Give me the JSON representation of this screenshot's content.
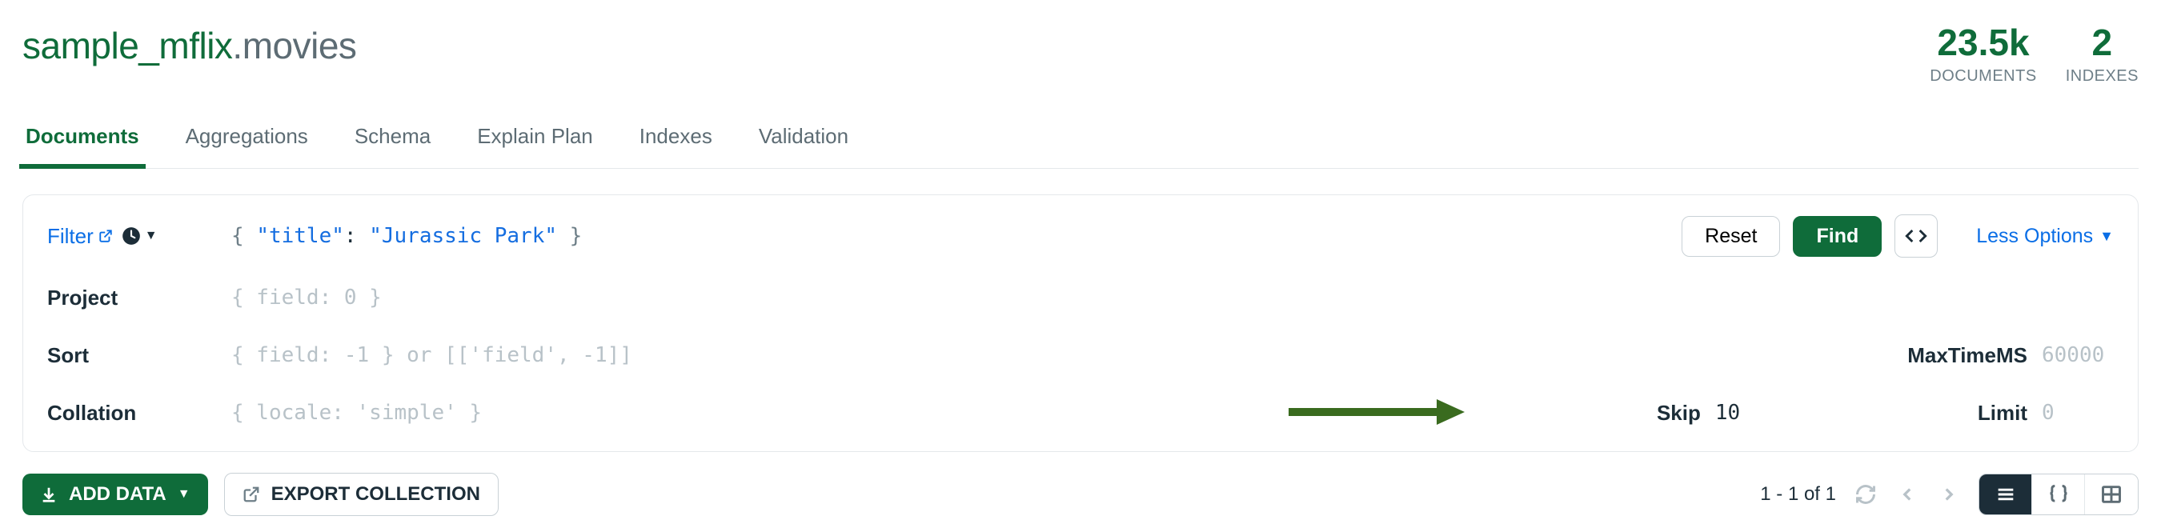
{
  "header": {
    "database": "sample_mflix",
    "collection": ".movies",
    "stats": {
      "documents_value": "23.5k",
      "documents_label": "DOCUMENTS",
      "indexes_value": "2",
      "indexes_label": "INDEXES"
    }
  },
  "tabs": {
    "documents": "Documents",
    "aggregations": "Aggregations",
    "schema": "Schema",
    "explain_plan": "Explain Plan",
    "indexes": "Indexes",
    "validation": "Validation"
  },
  "query": {
    "filter_label": "Filter",
    "filter_value_open": "{",
    "filter_key": "\"title\"",
    "filter_colon": ": ",
    "filter_str": "\"Jurassic Park\"",
    "filter_value_close": "}",
    "project_label": "Project",
    "project_placeholder": "{ field: 0 }",
    "sort_label": "Sort",
    "sort_placeholder": "{ field: -1 } or [['field', -1]]",
    "collation_label": "Collation",
    "collation_placeholder": "{ locale: 'simple' }",
    "maxtime_label": "MaxTimeMS",
    "maxtime_placeholder": "60000",
    "skip_label": "Skip",
    "skip_value": "10",
    "limit_label": "Limit",
    "limit_placeholder": "0",
    "reset_btn": "Reset",
    "find_btn": "Find",
    "options_link": "Less Options"
  },
  "toolbar": {
    "add_data": "ADD DATA",
    "export_collection": "EXPORT COLLECTION",
    "pager_text": "1 - 1 of 1"
  }
}
